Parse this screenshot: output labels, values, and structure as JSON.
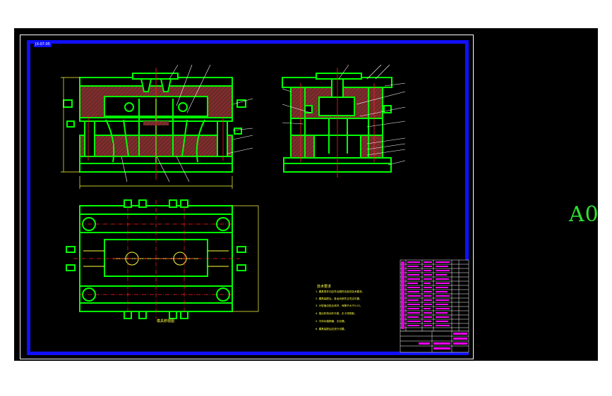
{
  "paper_size": "A0",
  "drawing_id": "JX-07-05",
  "view_label": "模具俯视图",
  "notes": {
    "title": "技术要求",
    "items": [
      "1. 模具零件均应符合图样及相关技术要求。",
      "2. 模具装配后，各运动部件应灵活可靠。",
      "3. 分型面应贴合良好，间隙不大于0.02。",
      "4. 推出机构动作平稳，无卡滞现象。",
      "5. 冷却水路畅通，无渗漏。",
      "6. 模具装配后应进行试模。"
    ]
  },
  "colors": {
    "background": "#000000",
    "sheet_border": "#1010ff",
    "outline": "#00ff00",
    "section_hatch": "#c03030",
    "centerline": "#ff2020",
    "leader": "#ffffff",
    "dimension": "#ffff40",
    "title_block": "#ff00ff",
    "text": "#ffffff"
  }
}
